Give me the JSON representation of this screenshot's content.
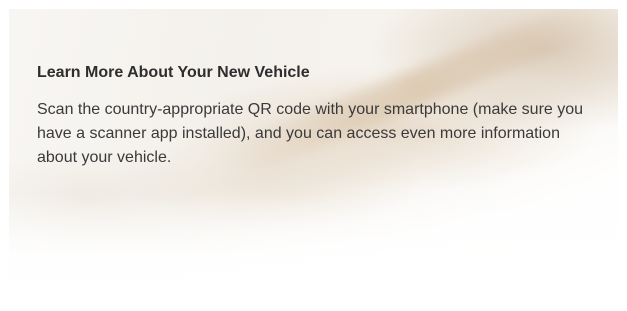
{
  "card": {
    "heading": "Learn More About Your New Vehicle",
    "body": "Scan the country-appropriate QR code with your smartphone (make sure you have a scanner app installed), and you can access even more information about your vehicle."
  }
}
